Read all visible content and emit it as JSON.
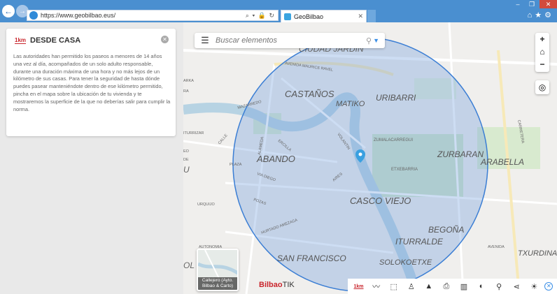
{
  "browser": {
    "url": "https://www.geobilbao.eus/",
    "tab_title": "GeoBilbao",
    "addr_tools": "⌕ ▾ 🔒 ↻"
  },
  "panel": {
    "logo": "1km",
    "title": "DESDE CASA",
    "body": "Las autoridades han permitido los paseos a menores de 14 años una vez al día, acompañados de un solo adulto responsable, durante una duración máxima de una hora y no más lejos de un kilómetro de sus casas. Para tener la seguridad de hasta dónde puedes pasear manteniéndote dentro de ese kilómetro permitido, pincha en el mapa sobre la ubicación de tu vivienda y te mostraremos la superficie de la que no deberías salir para cumplir la norma."
  },
  "search": {
    "placeholder": "Buscar elementos"
  },
  "map_labels": {
    "ciudad_jardin": "CIUDAD JARDIN",
    "castanos": "CASTAÑOS",
    "matiko": "MATIKO",
    "uribarri": "URIBARRI",
    "abando": "ABANDO",
    "zurbaran": "ZURBARAN",
    "arabella": "ARABELLA",
    "casco_viejo": "CASCO VIEJO",
    "begona": "BEGOÑA",
    "iturralde": "ITURRALDE",
    "san_francisco": "SAN FRANCISCO",
    "solokoetxe": "SOLOKOETXE",
    "txurdina": "TXURDINA",
    "zumalacarregui": "ZUMALACARREGUI",
    "etxebarria": "ETXEBARRIA",
    "avenida_maurice_ravel": "AVENIDA   MAURICE  RAVEL",
    "mazarredo": "MAZARREDO",
    "volantin": "VOLANTIN",
    "ercilla": "ERCILLA",
    "alameda": "ALAMEDA",
    "via_diego": "VIA    DIEGO",
    "pozas": "POZAS",
    "urquijo": "URQUIJO",
    "hurtado_amezaga": "HURTADO   AMEZAGA",
    "autonomia": "AUTONOMIA",
    "bailen": "AIRES",
    "avenida": "AVENIDA",
    "carretera": "CARRETERA",
    "iturrizar": "ITURRIZAR",
    "calle": "CALLE",
    "u": "U",
    "eo": "EO",
    "ol": "OL",
    "arka": "ARKA",
    "ra": "RA",
    "plaza": "PLAZA",
    "de": "DE"
  },
  "zoom": {
    "in": "+",
    "home": "⌂",
    "out": "−"
  },
  "thumbnail": {
    "label": "Callejero (Ayto. Bilbao & Carto)"
  },
  "brand": {
    "name": "Bilbao",
    "suffix": "TIK"
  },
  "toolbar": {
    "km": "1km",
    "line": "〰",
    "polygon": "⬚",
    "person": "♙",
    "profile": "▲",
    "print": "⎙",
    "columns": "▥",
    "globe": "◐",
    "user": "⚲",
    "share": "⋖",
    "sun": "☀",
    "close": "✕"
  },
  "colors": {
    "radius_fill": "#6f9fdc",
    "radius_stroke": "#3b7ed4",
    "marker": "#3aa0e0",
    "accent": "#c9252c"
  }
}
